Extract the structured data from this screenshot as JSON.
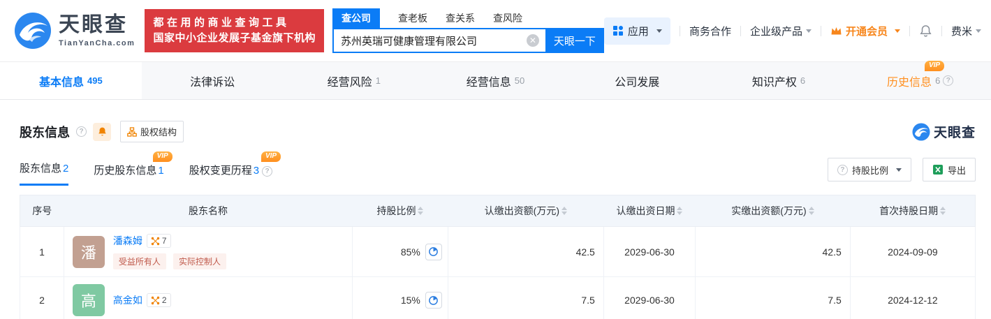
{
  "brand": {
    "logo_text": "天眼查",
    "logo_domain": "TianYanCha.com",
    "slogan_line1": "都在用的商业查询工具",
    "slogan_line2": "国家中小企业发展子基金旗下机构",
    "accent_color": "#0b7cf6",
    "banner_color": "#db3b3f"
  },
  "search": {
    "tabs": [
      "查公司",
      "查老板",
      "查关系",
      "查风险"
    ],
    "active_tab": "查公司",
    "value": "苏州英瑞可健康管理有限公司",
    "button_label": "天眼一下"
  },
  "topnav": {
    "app_label": "应用",
    "coop_label": "商务合作",
    "enterprise_label": "企业级产品",
    "vip_label": "开通会员",
    "vip_color": "#f7861c",
    "username": "费米"
  },
  "company_tabs": [
    {
      "label": "基本信息",
      "count": "495"
    },
    {
      "label": "法律诉讼",
      "count": ""
    },
    {
      "label": "经营风险",
      "count": "1"
    },
    {
      "label": "经营信息",
      "count": "50"
    },
    {
      "label": "公司发展",
      "count": ""
    },
    {
      "label": "知识产权",
      "count": "6"
    },
    {
      "label": "历史信息",
      "count": "6",
      "badge": "VIP"
    }
  ],
  "section": {
    "title": "股东信息",
    "structure_button": "股权结构",
    "watermark": "天眼查"
  },
  "subtabs": [
    {
      "label": "股东信息",
      "count": "2"
    },
    {
      "label": "历史股东信息",
      "count": "1",
      "badge": "VIP"
    },
    {
      "label": "股权变更历程",
      "count": "3",
      "badge": "VIP"
    }
  ],
  "toolbar": {
    "ratio_button": "持股比例",
    "export_button": "导出"
  },
  "table": {
    "headers": [
      "序号",
      "股东名称",
      "持股比例",
      "认缴出资额(万元)",
      "认缴出资日期",
      "实缴出资额(万元)",
      "首次持股日期"
    ],
    "rows": [
      {
        "index": "1",
        "name": "潘森姆",
        "avatar_char": "潘",
        "avatar_color": "#c2a091",
        "link_count": "7",
        "tag1": "受益所有人",
        "tag2": "实际控制人",
        "ratio": "85%",
        "subscribed_amount": "42.5",
        "subscribed_date": "2029-06-30",
        "paid_amount": "42.5",
        "first_hold_date": "2024-09-09"
      },
      {
        "index": "2",
        "name": "高金如",
        "avatar_char": "高",
        "avatar_color": "#7fc9a2",
        "link_count": "2",
        "ratio": "15%",
        "subscribed_amount": "7.5",
        "subscribed_date": "2029-06-30",
        "paid_amount": "7.5",
        "first_hold_date": "2024-12-12"
      }
    ]
  }
}
